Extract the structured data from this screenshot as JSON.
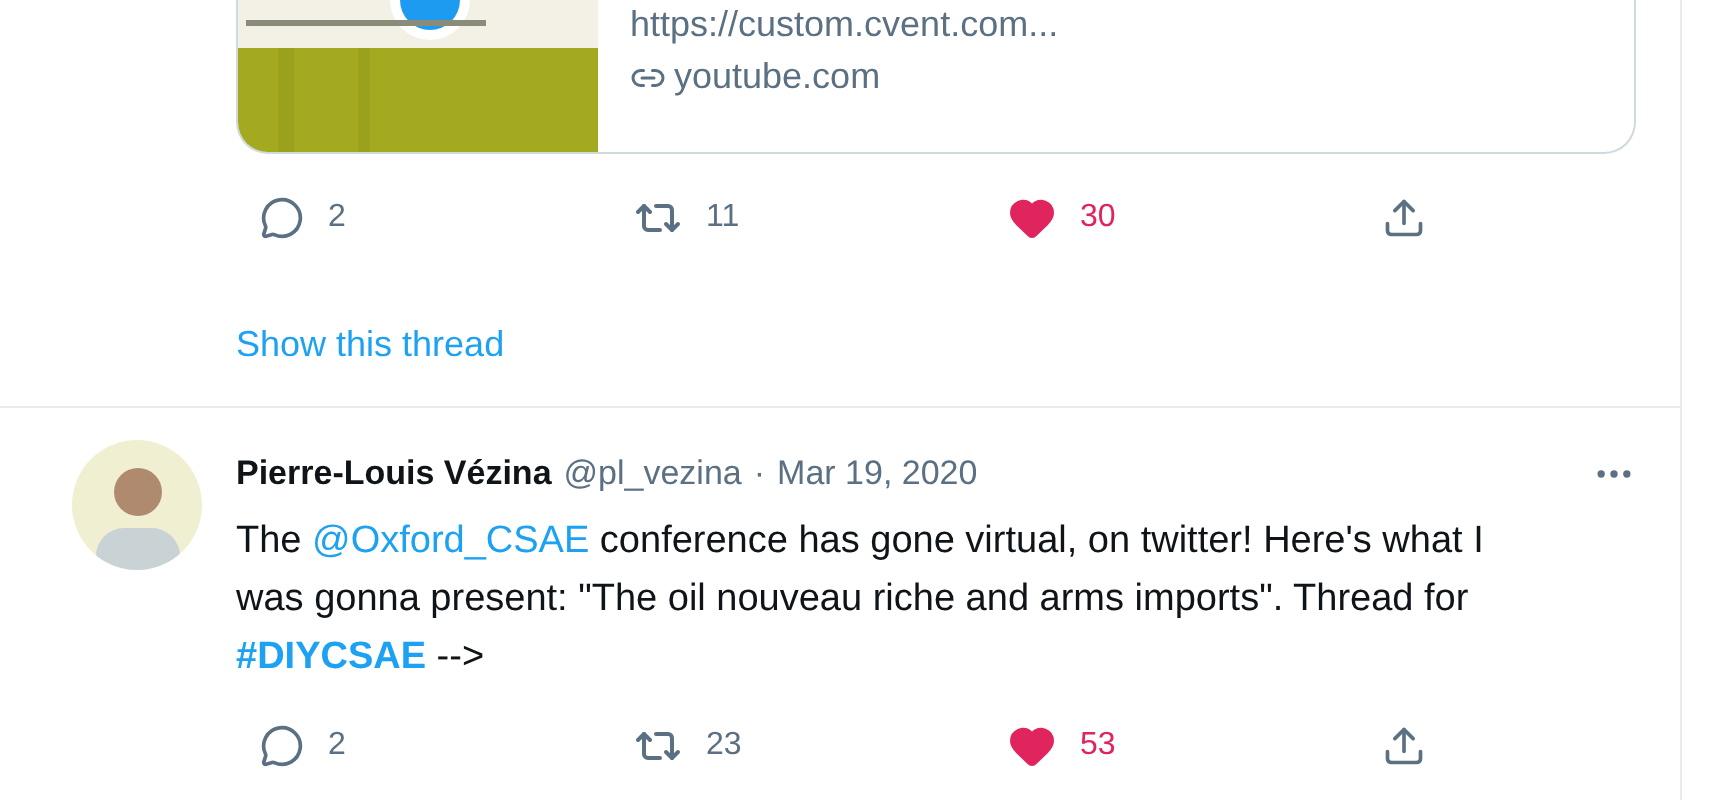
{
  "thread_tweet": {
    "link_card": {
      "url": "https://custom.cvent.com...",
      "domain": "youtube.com"
    },
    "actions": [
      {
        "kind": "reply",
        "count": "2"
      },
      {
        "kind": "retweet",
        "count": "11"
      },
      {
        "kind": "like",
        "count": "30",
        "liked": true
      },
      {
        "kind": "share"
      }
    ],
    "show_thread": "Show this thread"
  },
  "tweet": {
    "author": "Pierre-Louis Vézina",
    "handle": "@pl_vezina",
    "separator": "·",
    "date": "Mar 19, 2020",
    "text": [
      {
        "kind": "text",
        "text": "The "
      },
      {
        "kind": "mention",
        "text": "@Oxford_CSAE"
      },
      {
        "kind": "text",
        "text": " conference has gone virtual, on twitter! Here's what I was gonna present: \"The oil nouveau riche and arms imports\". Thread for "
      },
      {
        "kind": "hashtag",
        "text": "#DIYCSAE"
      },
      {
        "kind": "text",
        "text": " -->"
      }
    ],
    "actions": [
      {
        "kind": "reply",
        "count": "2"
      },
      {
        "kind": "retweet",
        "count": "23"
      },
      {
        "kind": "like",
        "count": "53",
        "liked": true
      },
      {
        "kind": "share"
      }
    ]
  }
}
